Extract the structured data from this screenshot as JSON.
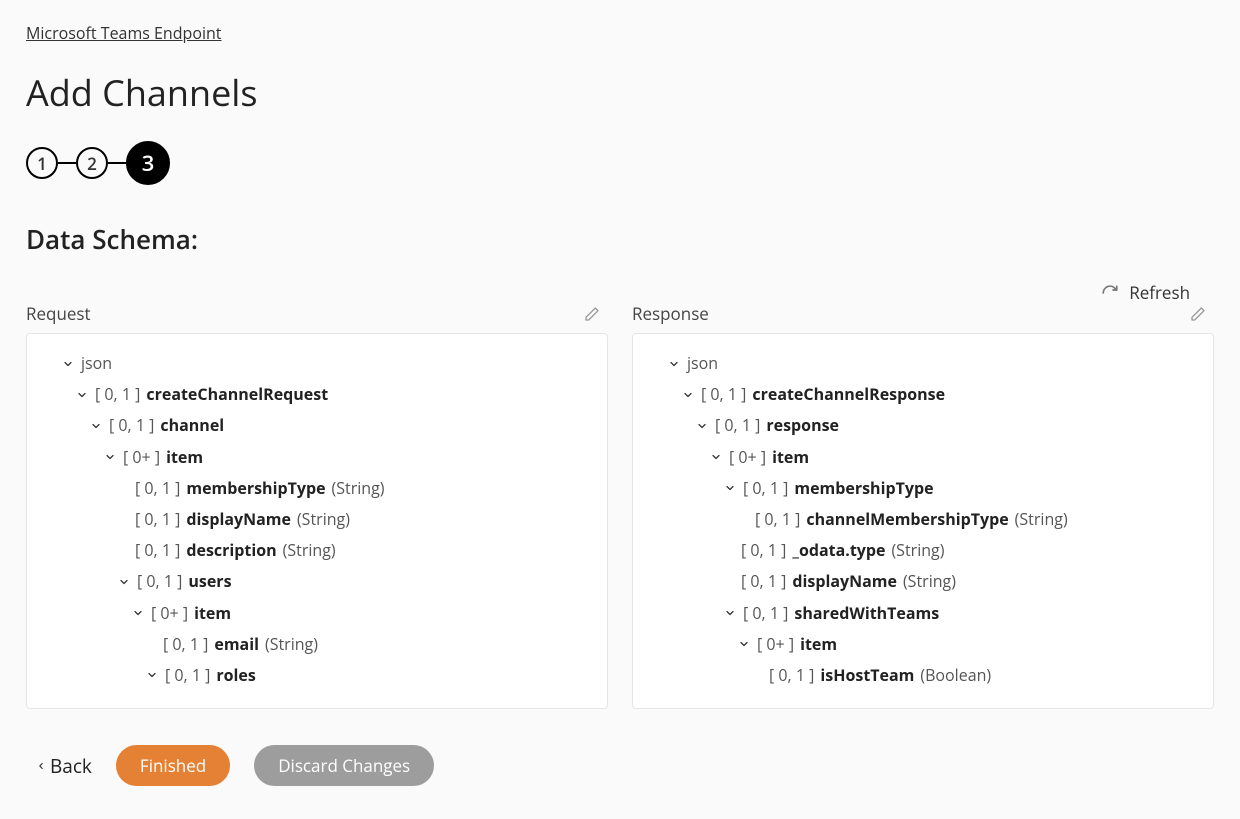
{
  "breadcrumb": "Microsoft Teams Endpoint",
  "title": "Add Channels",
  "steps": [
    "1",
    "2",
    "3"
  ],
  "active_step": 3,
  "section_title": "Data Schema:",
  "refresh_label": "Refresh",
  "panels": {
    "request": {
      "title": "Request",
      "root": "json",
      "tree": [
        {
          "indent": 1,
          "expand": true,
          "card": "[ 0, 1 ]",
          "name": "createChannelRequest",
          "type": ""
        },
        {
          "indent": 2,
          "expand": true,
          "card": "[ 0, 1 ]",
          "name": "channel",
          "type": ""
        },
        {
          "indent": 3,
          "expand": true,
          "card": "[ 0+ ]",
          "name": "item",
          "type": ""
        },
        {
          "indent": 4,
          "expand": false,
          "card": "[ 0, 1 ]",
          "name": "membershipType",
          "type": "(String)"
        },
        {
          "indent": 4,
          "expand": false,
          "card": "[ 0, 1 ]",
          "name": "displayName",
          "type": "(String)"
        },
        {
          "indent": 4,
          "expand": false,
          "card": "[ 0, 1 ]",
          "name": "description",
          "type": "(String)"
        },
        {
          "indent": 4,
          "expand": true,
          "card": "[ 0, 1 ]",
          "name": "users",
          "type": ""
        },
        {
          "indent": 5,
          "expand": true,
          "card": "[ 0+ ]",
          "name": "item",
          "type": ""
        },
        {
          "indent": 6,
          "expand": false,
          "card": "[ 0, 1 ]",
          "name": "email",
          "type": "(String)"
        },
        {
          "indent": 6,
          "expand": true,
          "card": "[ 0, 1 ]",
          "name": "roles",
          "type": ""
        }
      ]
    },
    "response": {
      "title": "Response",
      "root": "json",
      "tree": [
        {
          "indent": 1,
          "expand": true,
          "card": "[ 0, 1 ]",
          "name": "createChannelResponse",
          "type": ""
        },
        {
          "indent": 2,
          "expand": true,
          "card": "[ 0, 1 ]",
          "name": "response",
          "type": ""
        },
        {
          "indent": 3,
          "expand": true,
          "card": "[ 0+ ]",
          "name": "item",
          "type": ""
        },
        {
          "indent": 4,
          "expand": true,
          "card": "[ 0, 1 ]",
          "name": "membershipType",
          "type": ""
        },
        {
          "indent": 5,
          "expand": false,
          "card": "[ 0, 1 ]",
          "name": "channelMembershipType",
          "type": "(String)"
        },
        {
          "indent": 4,
          "expand": false,
          "card": "[ 0, 1 ]",
          "name": "_odata.type",
          "type": "(String)"
        },
        {
          "indent": 4,
          "expand": false,
          "card": "[ 0, 1 ]",
          "name": "displayName",
          "type": "(String)"
        },
        {
          "indent": 4,
          "expand": true,
          "card": "[ 0, 1 ]",
          "name": "sharedWithTeams",
          "type": ""
        },
        {
          "indent": 5,
          "expand": true,
          "card": "[ 0+ ]",
          "name": "item",
          "type": ""
        },
        {
          "indent": 6,
          "expand": false,
          "card": "[ 0, 1 ]",
          "name": "isHostTeam",
          "type": "(Boolean)"
        }
      ]
    }
  },
  "footer": {
    "back": "Back",
    "finished": "Finished",
    "discard": "Discard Changes"
  }
}
